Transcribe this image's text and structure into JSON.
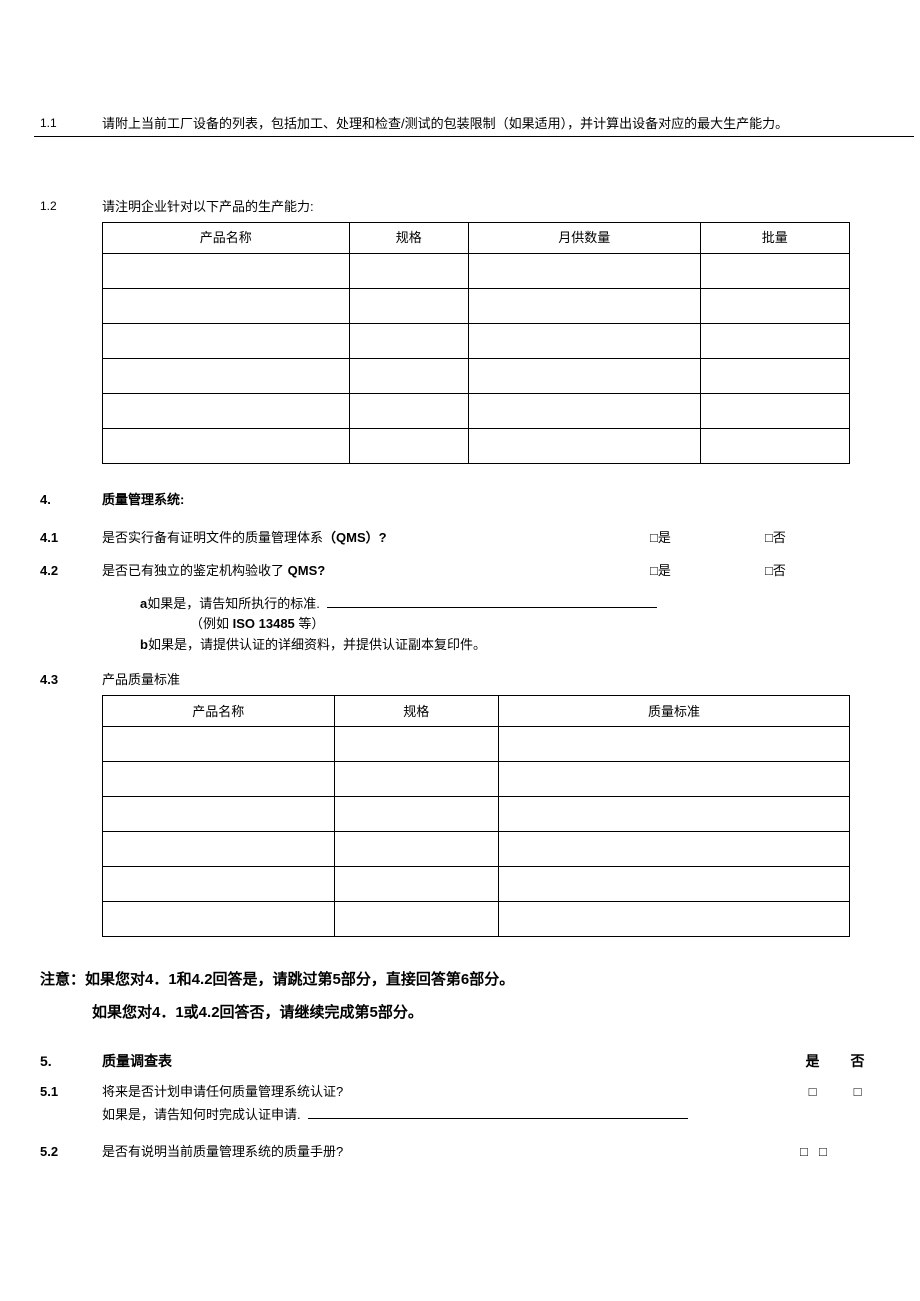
{
  "items": {
    "i1_1": {
      "num": "1.1",
      "text": "请附上当前工厂设备的列表，包括加工、处理和检查/测试的包装限制（如果适用），并计算出设备对应的最大生产能力。"
    },
    "i1_2": {
      "num": "1.2",
      "text": "请注明企业针对以下产品的生产能力:"
    }
  },
  "table1": {
    "headers": {
      "c1": "产品名称",
      "c2": "规格",
      "c3": "月供数量",
      "c4": "批量"
    },
    "row_count": 6
  },
  "sec4": {
    "num": "4.",
    "title": "质量管理系统:",
    "q1": {
      "num": "4.1",
      "text_a": "是否实行备有证明文件的质量管理体系",
      "text_b": "（QMS）?"
    },
    "q2": {
      "num": "4.2",
      "text": "是否已有独立的鉴定机构验收了 ",
      "bold": "QMS?"
    },
    "opt_yes": "□是",
    "opt_no": "□否",
    "note_a_label": "a",
    "note_a_text": "如果是，请告知所执行的标准.",
    "note_a_example_prefix": "（例如 ",
    "note_a_example_bold": "ISO 13485",
    "note_a_example_suffix": " 等）",
    "note_b_label": "b",
    "note_b_text": "如果是，请提供认证的详细资料，并提供认证副本复印件。",
    "q3": {
      "num": "4.3",
      "text": "产品质量标准"
    }
  },
  "table2": {
    "headers": {
      "c1": "产品名称",
      "c2": "规格",
      "c3": "质量标准"
    },
    "row_count": 6
  },
  "notice": {
    "line1": "注意：如果您对4．1和4.2回答是，请跳过第5部分，直接回答第6部分。",
    "line2": "如果您对4．1或4.2回答否，请继续完成第5部分。"
  },
  "sec5": {
    "num": "5.",
    "title": "质量调查表",
    "col_yes": "是",
    "col_no": "否",
    "q1": {
      "num": "5.1",
      "text1": "将来是否计划申请任何质量管理系统认证?",
      "text2": "如果是，请告知何时完成认证申请."
    },
    "q2": {
      "num": "5.2",
      "text": "是否有说明当前质量管理系统的质量手册?"
    },
    "checkbox": "□"
  }
}
